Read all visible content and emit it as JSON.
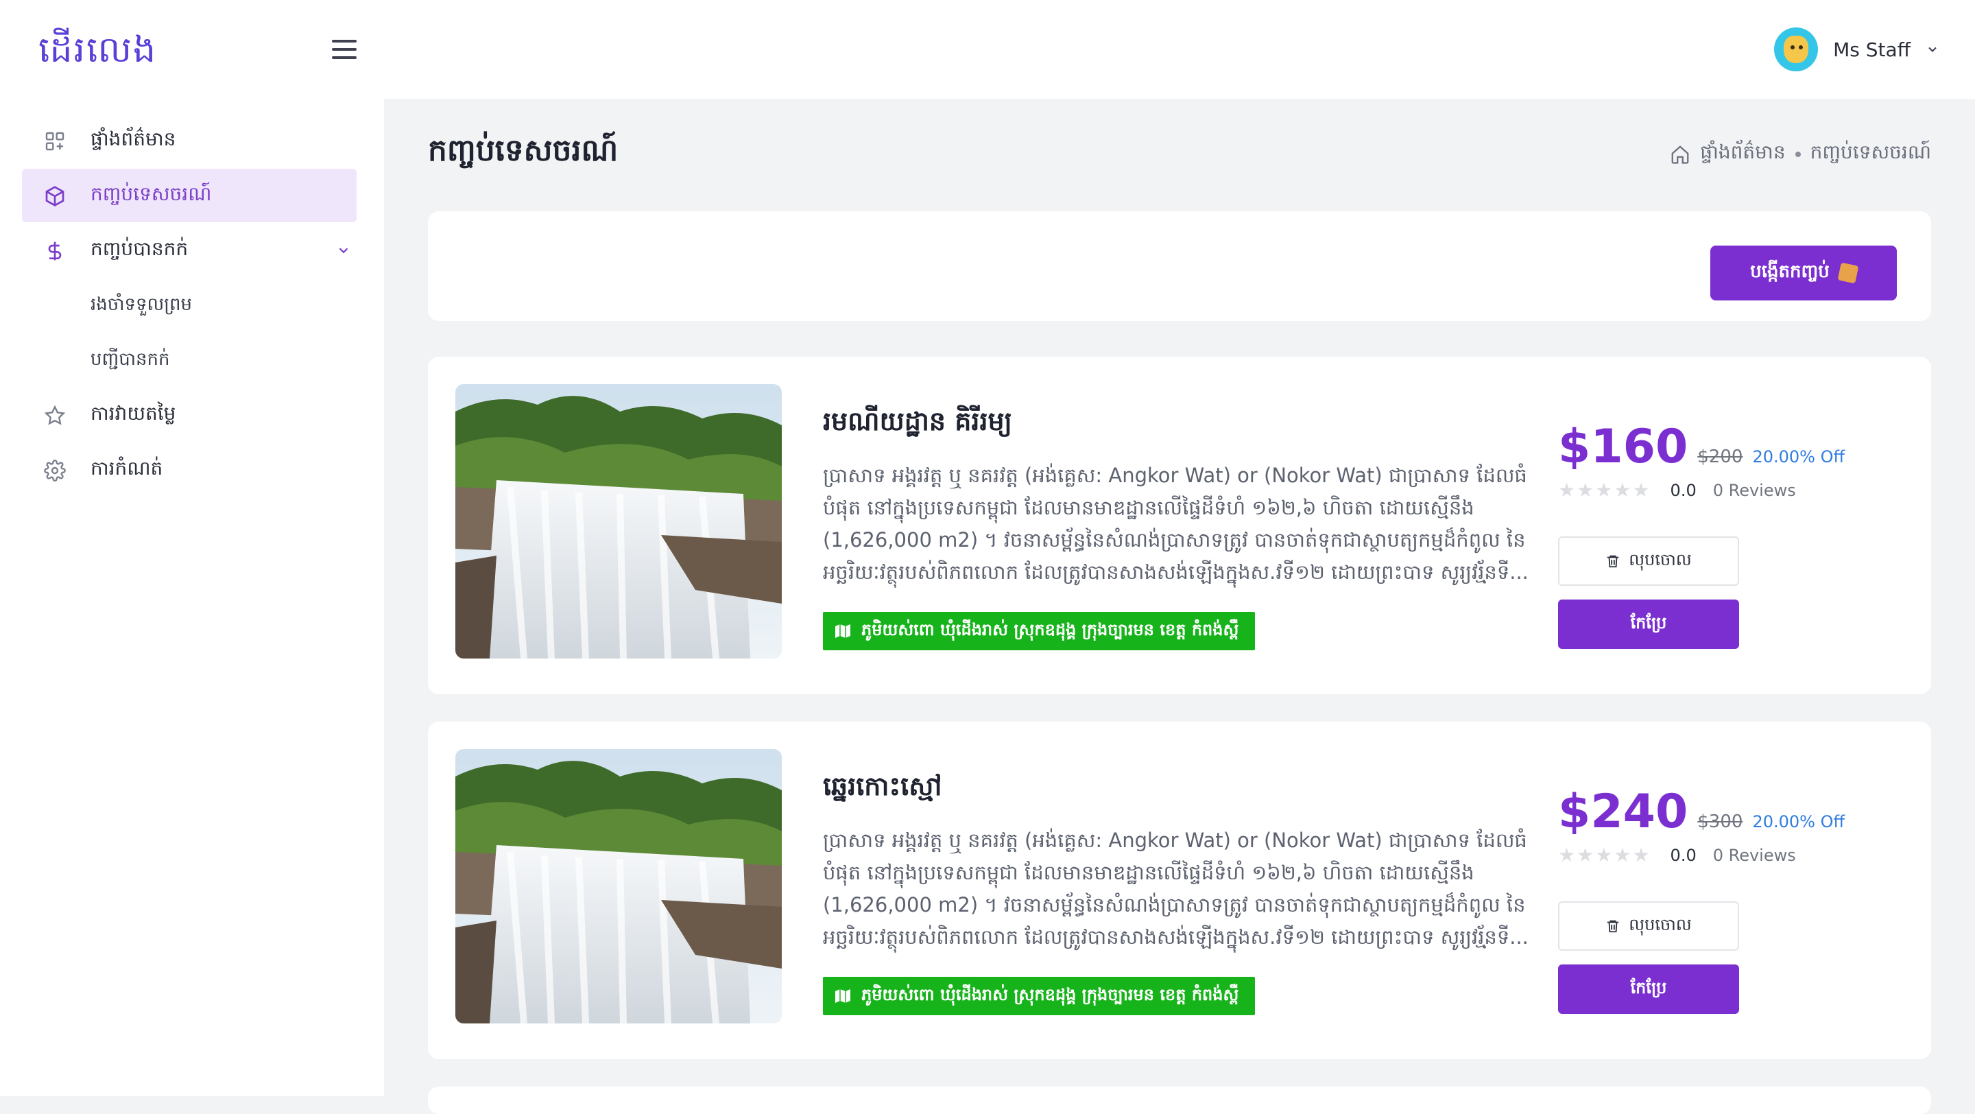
{
  "sidebar": {
    "logo": "ដើរលេង",
    "items": [
      {
        "label": "ផ្ទាំងព័ត៌មាន",
        "icon": "dashboard-icon"
      },
      {
        "label": "កញ្ចប់ទេសចរណ៍",
        "icon": "package-icon",
        "active": true
      },
      {
        "label": "កញ្ចប់បានកក់",
        "icon": "dollar-icon"
      },
      {
        "label": "ការវាយតម្លៃ",
        "icon": "star-icon"
      },
      {
        "label": "ការកំណត់",
        "icon": "gear-icon"
      }
    ],
    "subitems": [
      "រងចាំទទួលព្រម",
      "បញ្ជីបានកក់"
    ]
  },
  "header": {
    "user_name": "Ms Staff"
  },
  "page": {
    "title": "កញ្ចប់ទេសចរណ៍",
    "breadcrumb": [
      "ផ្ទាំងព័ត៌មាន",
      "កញ្ចប់ទេសចរណ៍"
    ],
    "create_label": "បង្កើតកញ្ចប់"
  },
  "packages": [
    {
      "title": "រមណីយដ្ឋាន គិរីរម្យ",
      "description": "ប្រាសាទ អង្គរវត្ត ឬ នគរវត្ត (អង់គ្លេស: Angkor Wat) or (Nokor Wat) ជាប្រាសាទ ដែលធំបំផុត នៅក្នុងប្រទេសកម្ពុជា ដែលមានមាឌដ្ឋានលើផ្ទៃដីទំហំ ១៦២,៦ ហិចតា ដោយស្មើនឹង (1,626,000 m2) ។ វចនាសម្ព័ន្ធនៃសំណង់ប្រាសាទត្រូវ បានចាត់ទុកជាស្ថាបត្យកម្មដ៏កំពូល នៃអច្ឆរិយៈវត្ថុរបស់ពិភពលោក ដែលត្រូវបានសាងសង់ឡើងក្នុងស.វទី១២ ដោយព្រះបាទ សូរ្យវរ្ម័នទី...",
      "location": "ភូមិយស់ពោ ឃុំដើងរាស់ ស្រុកឧដុង្គ ក្រុងច្បារមន ខេត្ត កំពង់ស្ពឺ",
      "price": "$160",
      "old_price": "$200",
      "discount": "20.00% Off",
      "rating": "0.0",
      "reviews": "0 Reviews",
      "rating_value": 0,
      "delete_label": "លុបចោល",
      "edit_label": "កែប្រែ"
    },
    {
      "title": "ឆ្នេរកោះស្មៅ",
      "description": "ប្រាសាទ អង្គរវត្ត ឬ នគរវត្ត (អង់គ្លេស: Angkor Wat) or (Nokor Wat) ជាប្រាសាទ ដែលធំបំផុត នៅក្នុងប្រទេសកម្ពុជា ដែលមានមាឌដ្ឋានលើផ្ទៃដីទំហំ ១៦២,៦ ហិចតា ដោយស្មើនឹង (1,626,000 m2) ។ វចនាសម្ព័ន្ធនៃសំណង់ប្រាសាទត្រូវ បានចាត់ទុកជាស្ថាបត្យកម្មដ៏កំពូល នៃអច្ឆរិយៈវត្ថុរបស់ពិភពលោក ដែលត្រូវបានសាងសង់ឡើងក្នុងស.វទី១២ ដោយព្រះបាទ សូរ្យវរ្ម័នទី...",
      "location": "ភូមិយស់ពោ ឃុំដើងរាស់ ស្រុកឧដុង្គ ក្រុងច្បារមន ខេត្ត កំពង់ស្ពឺ",
      "price": "$240",
      "old_price": "$300",
      "discount": "20.00% Off",
      "rating": "0.0",
      "reviews": "0 Reviews",
      "rating_value": 0,
      "delete_label": "លុបចោល",
      "edit_label": "កែប្រែ"
    }
  ],
  "colors": {
    "accent": "#7b2fd0",
    "active_bg": "#efe6fb",
    "location_bg": "#17b31b",
    "discount": "#2f7de0"
  }
}
